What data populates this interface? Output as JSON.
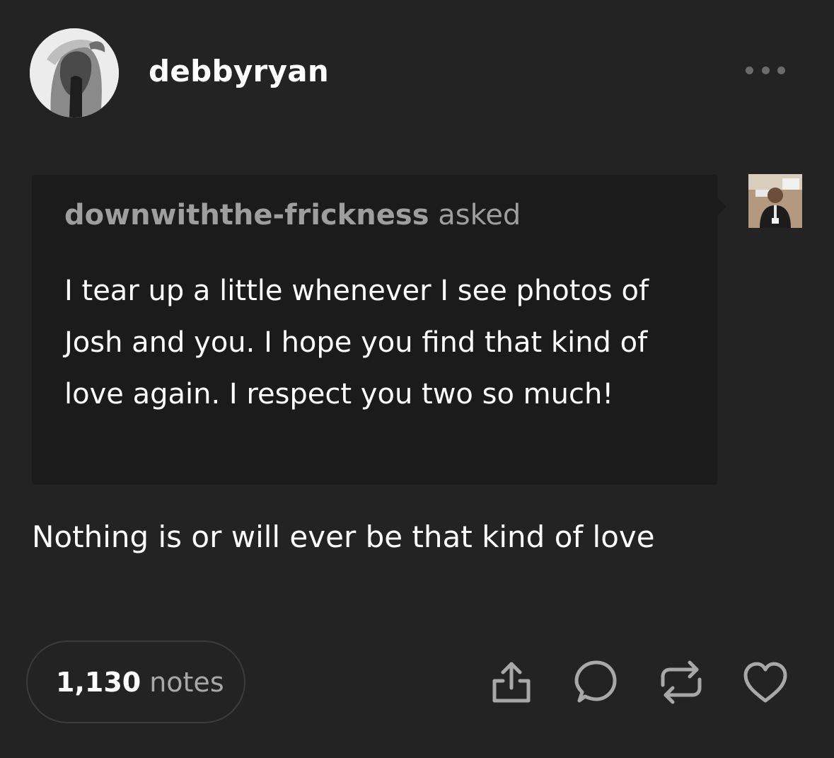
{
  "post": {
    "author": "debbyryan",
    "more_icon": "ellipsis-icon"
  },
  "ask": {
    "asker": "downwiththe-frickness",
    "verb": "asked",
    "question": "I tear up a little whenever I see photos of Josh and you. I hope you find that kind of love again. I respect you two so much!"
  },
  "answer": {
    "text": "Nothing is or will ever be that kind of love"
  },
  "footer": {
    "notes_count": "1,130",
    "notes_label": "notes",
    "actions": [
      "share-icon",
      "comment-icon",
      "reblog-icon",
      "heart-icon"
    ]
  },
  "colors": {
    "background": "#232323",
    "ask_box": "#1b1b1b",
    "muted_text": "#9e9e9e"
  }
}
